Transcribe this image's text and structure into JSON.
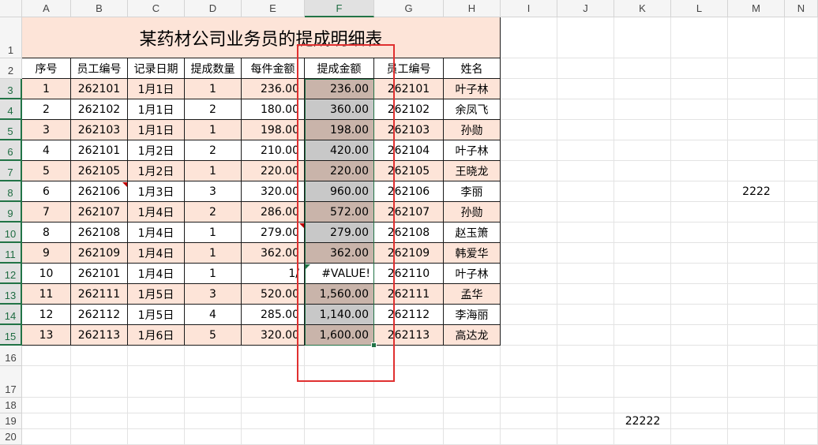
{
  "columns": [
    "A",
    "B",
    "C",
    "D",
    "E",
    "F",
    "G",
    "H",
    "I",
    "J",
    "K",
    "L",
    "M",
    "N"
  ],
  "rows": [
    "1",
    "2",
    "3",
    "4",
    "5",
    "6",
    "7",
    "8",
    "9",
    "10",
    "11",
    "12",
    "13",
    "14",
    "15",
    "16",
    "17",
    "18",
    "19",
    "20"
  ],
  "selected_column": "F",
  "title": "某药材公司业务员的提成明细表",
  "headers": [
    "序号",
    "员工编号",
    "记录日期",
    "提成数量",
    "每件金额",
    "提成金额",
    "员工编号",
    "姓名"
  ],
  "table": [
    [
      "1",
      "262101",
      "1月1日",
      "1",
      "236.00",
      "236.00",
      "262101",
      "叶子林"
    ],
    [
      "2",
      "262102",
      "1月1日",
      "2",
      "180.00",
      "360.00",
      "262102",
      "余凤飞"
    ],
    [
      "3",
      "262103",
      "1月1日",
      "1",
      "198.00",
      "198.00",
      "262103",
      "孙勋"
    ],
    [
      "4",
      "262101",
      "1月2日",
      "2",
      "210.00",
      "420.00",
      "262104",
      "叶子林"
    ],
    [
      "5",
      "262105",
      "1月2日",
      "1",
      "220.00",
      "220.00",
      "262105",
      "王晓龙"
    ],
    [
      "6",
      "262106",
      "1月3日",
      "3",
      "320.00",
      "960.00",
      "262106",
      "李丽"
    ],
    [
      "7",
      "262107",
      "1月4日",
      "2",
      "286.00",
      "572.00",
      "262107",
      "孙勋"
    ],
    [
      "8",
      "262108",
      "1月4日",
      "1",
      "279.00",
      "279.00",
      "262108",
      "赵玉箫"
    ],
    [
      "9",
      "262109",
      "1月4日",
      "1",
      "362.00",
      "362.00",
      "262109",
      "韩爱华"
    ],
    [
      "10",
      "262101",
      "1月4日",
      "1",
      "1/",
      "#VALUE!",
      "262110",
      "叶子林"
    ],
    [
      "11",
      "262111",
      "1月5日",
      "3",
      "520.00",
      "1,560.00",
      "262111",
      "孟华"
    ],
    [
      "12",
      "262112",
      "1月5日",
      "4",
      "285.00",
      "1,140.00",
      "262112",
      "李海丽"
    ],
    [
      "13",
      "262113",
      "1月6日",
      "5",
      "320.00",
      "1,600.00",
      "262113",
      "高达龙"
    ]
  ],
  "extra_cells": {
    "m8": "2222",
    "k19": "22222"
  },
  "colors": {
    "peach": "#fde4d8",
    "selection": "#217346",
    "annotation_box": "#e03030"
  }
}
